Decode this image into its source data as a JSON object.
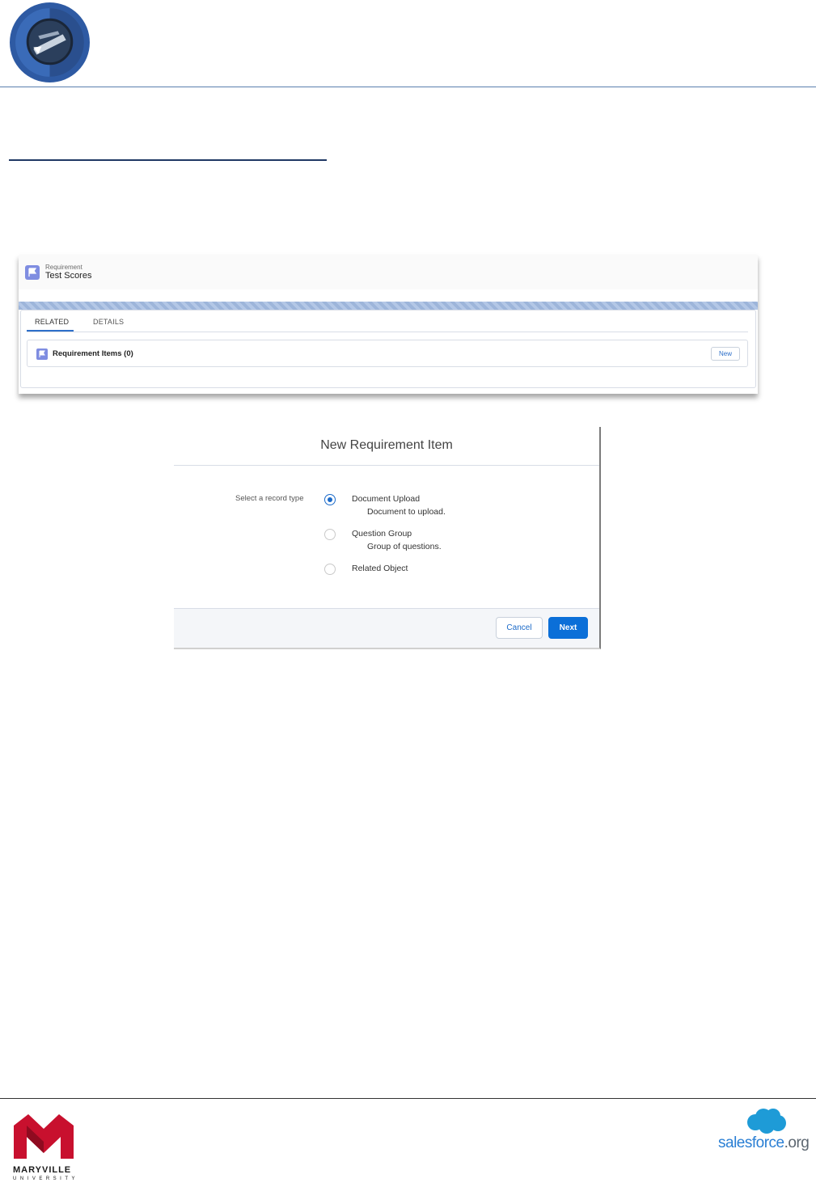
{
  "header": {
    "logo_icon": "circular-e-emblem-icon"
  },
  "record": {
    "object_type": "Requirement",
    "name": "Test Scores",
    "tabs": [
      {
        "label": "RELATED"
      },
      {
        "label": "DETAILS"
      }
    ],
    "related_list": {
      "title": "Requirement Items (0)",
      "new_label": "New"
    }
  },
  "modal": {
    "title": "New Requirement Item",
    "select_label": "Select a record type",
    "options": [
      {
        "name": "Document Upload",
        "description": "Document to upload.",
        "selected": true
      },
      {
        "name": "Question Group",
        "description": "Group of questions.",
        "selected": false
      },
      {
        "name": "Related Object",
        "description": "",
        "selected": false
      }
    ],
    "cancel_label": "Cancel",
    "next_label": "Next"
  },
  "footer": {
    "left_logo": {
      "name": "MARYVILLE",
      "sub": "UNIVERSITY"
    },
    "right_logo": {
      "brand": "salesforce",
      "suffix": ".org"
    }
  },
  "colors": {
    "accent_blue": "#0b6fd8",
    "maryville_red": "#c8102e",
    "salesforce_blue": "#2a7fd4"
  }
}
